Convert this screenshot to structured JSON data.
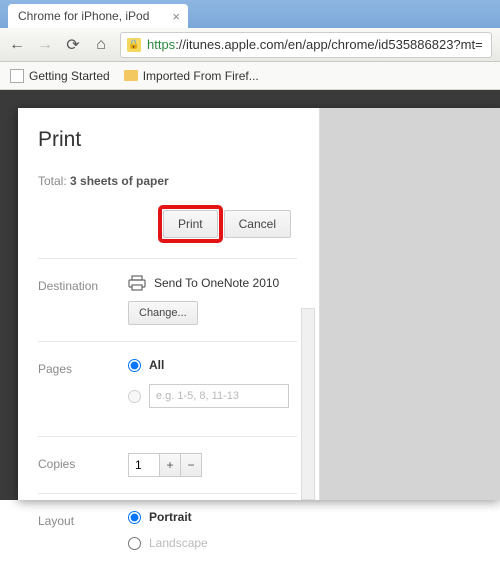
{
  "tab": {
    "title": "Chrome for iPhone, iPod"
  },
  "url": {
    "https": "https",
    "rest": "://itunes.apple.com/en/app/chrome/id535886823?mt="
  },
  "bookmarks": {
    "item1": "Getting Started",
    "item2": "Imported From Firef..."
  },
  "print": {
    "title": "Print",
    "total_prefix": "Total: ",
    "total_value": "3 sheets of paper",
    "print_btn": "Print",
    "cancel_btn": "Cancel",
    "destination_label": "Destination",
    "destination_value": "Send To OneNote 2010",
    "change_btn": "Change...",
    "pages_label": "Pages",
    "pages_all": "All",
    "pages_placeholder": "e.g. 1-5, 8, 11-13",
    "copies_label": "Copies",
    "copies_value": "1",
    "layout_label": "Layout",
    "layout_portrait": "Portrait",
    "layout_landscape": "Landscape"
  }
}
